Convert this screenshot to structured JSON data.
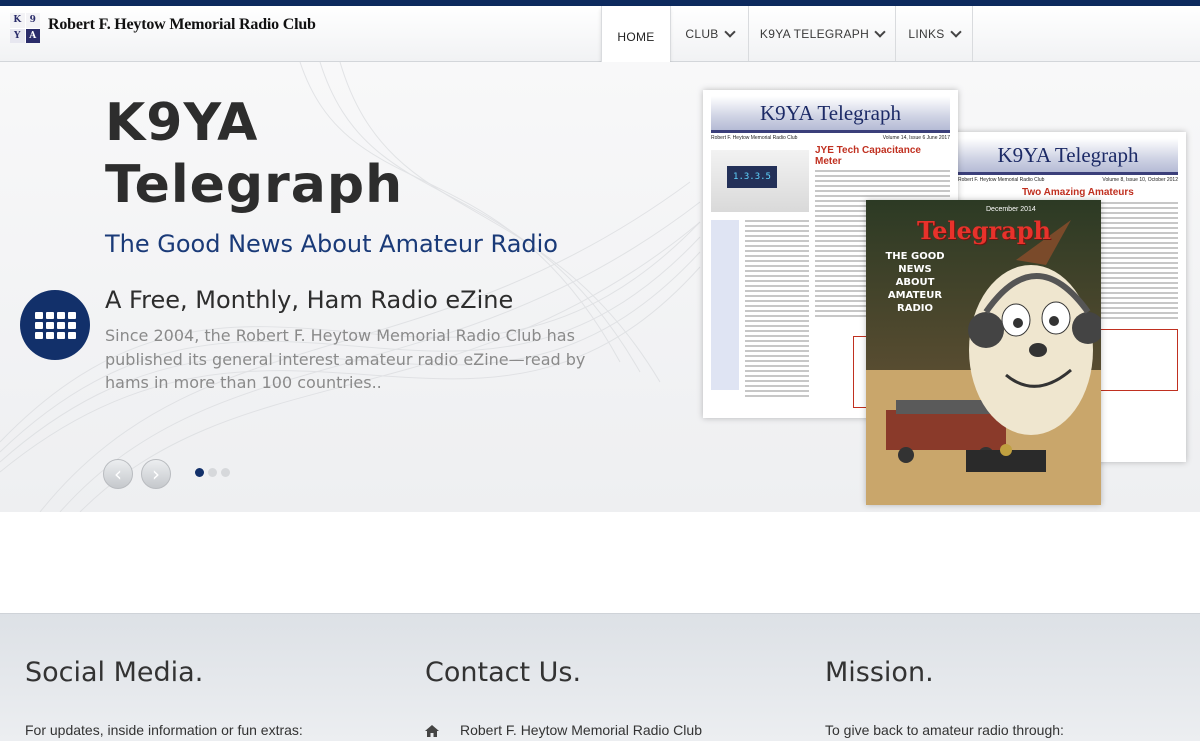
{
  "header": {
    "site_name": "Robert F. Heytow Memorial Radio Club",
    "logo": {
      "cells": [
        "K",
        "9",
        "Y",
        "A"
      ]
    },
    "nav": [
      {
        "label": "HOME",
        "active": true,
        "has_dropdown": false
      },
      {
        "label": "CLUB",
        "active": false,
        "has_dropdown": true
      },
      {
        "label": "K9YA TELEGRAPH",
        "active": false,
        "has_dropdown": true
      },
      {
        "label": "LINKS",
        "active": false,
        "has_dropdown": true
      }
    ]
  },
  "hero": {
    "title_line1": "K9YA",
    "title_line2": "Telegraph",
    "subtitle": "The Good News About Amateur Radio",
    "feature_icon": "grid-icon",
    "feature_heading": "A Free, Monthly, Ham Radio eZine",
    "feature_text": "Since 2004, the Robert F. Heytow Memorial Radio Club has published its general interest amateur radio eZine—read by hams in more than 100 countries..",
    "prev_label": "‹",
    "next_label": "›",
    "slides": {
      "count": 3,
      "active_index": 0
    },
    "covers": [
      {
        "masthead": "K9YA Telegraph",
        "club": "Robert F. Heytow Memorial Radio Club",
        "issue": "Volume 14, Issue 6  June 2017",
        "article": "JYE Tech Capacitance Meter",
        "lcd": "1.3.3.5"
      },
      {
        "masthead": "K9YA Telegraph",
        "club": "Robert F. Heytow Memorial Radio Club",
        "issue": "Volume 8, Issue 10,  October 2012",
        "article": "Two Amazing Amateurs"
      },
      {
        "masthead": "Telegraph",
        "date": "December 2014",
        "tagline": "THE GOOD NEWS ABOUT AMATEUR RADIO"
      }
    ]
  },
  "footer": {
    "columns": [
      {
        "title": "Social Media.",
        "text": "For updates, inside information or fun extras:"
      },
      {
        "title": "Contact Us.",
        "text": "Robert F. Heytow Memorial Radio Club",
        "icon": "home-icon"
      },
      {
        "title": "Mission.",
        "text": "To give back to amateur radio through:"
      }
    ]
  },
  "colors": {
    "navy": "#12306a",
    "top_strip": "#0d2a5e",
    "subtitle_blue": "#1a3a78"
  }
}
